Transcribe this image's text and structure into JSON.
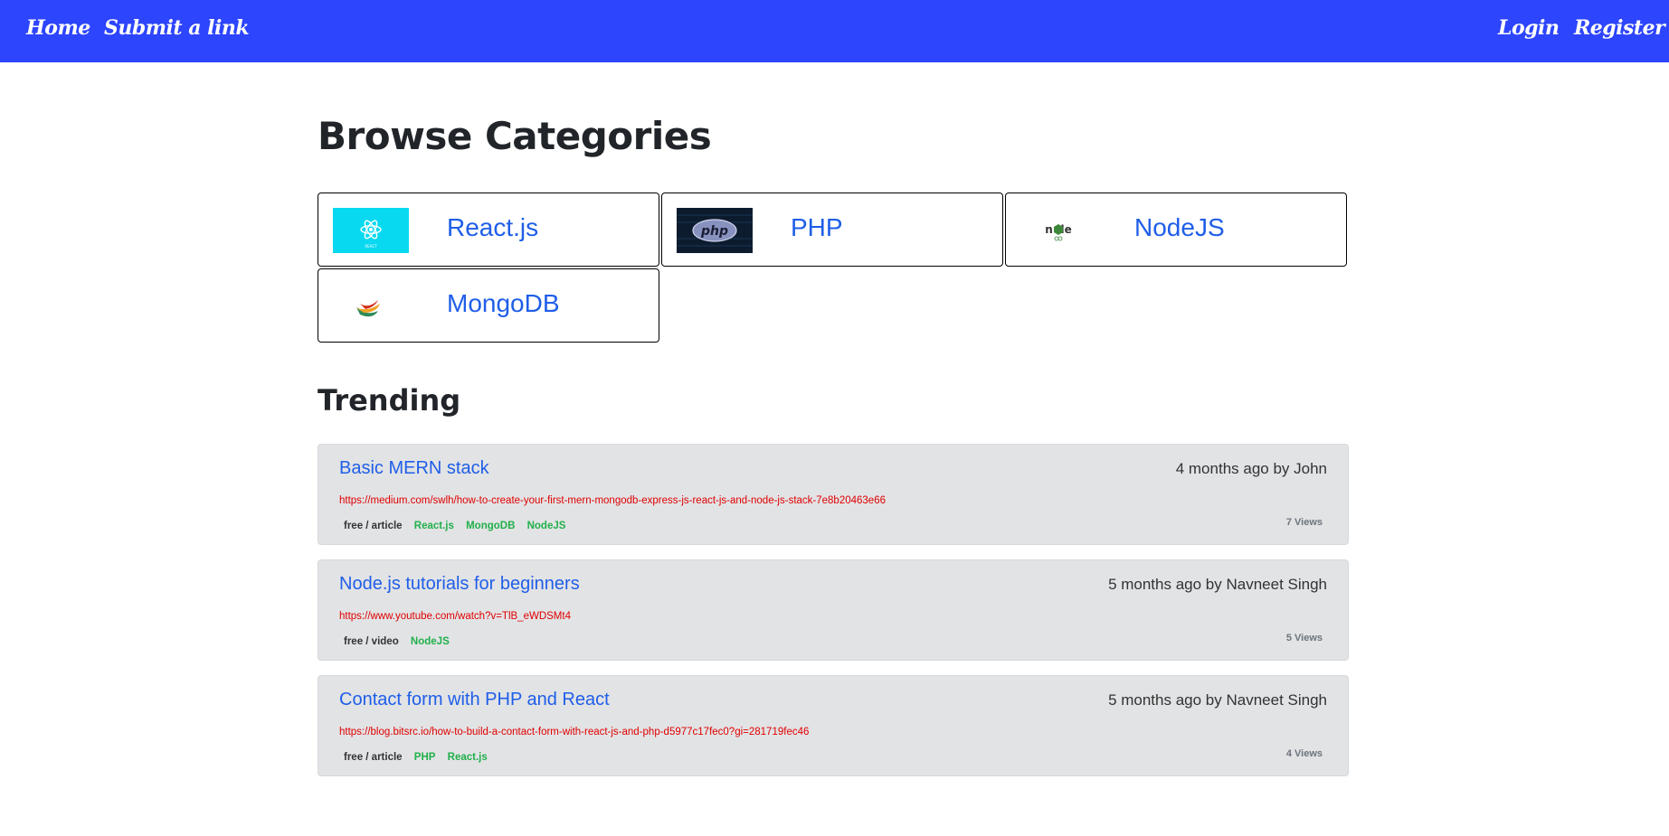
{
  "nav": {
    "home": "Home",
    "submit": "Submit a link",
    "login": "Login",
    "register": "Register"
  },
  "browse_heading": "Browse Categories",
  "categories": [
    {
      "name": "React.js",
      "icon": "react-logo-icon"
    },
    {
      "name": "PHP",
      "icon": "php-logo-icon"
    },
    {
      "name": "NodeJS",
      "icon": "nodejs-logo-icon"
    },
    {
      "name": "MongoDB",
      "icon": "mongodb-logo-icon"
    }
  ],
  "trending_heading": "Trending",
  "trending": [
    {
      "title": "Basic MERN stack",
      "meta": "4 months ago by John",
      "url": "https://medium.com/swlh/how-to-create-your-first-mern-mongodb-express-js-react-js-and-node-js-stack-7e8b20463e66",
      "type": "free / article",
      "tags": [
        "React.js",
        "MongoDB",
        "NodeJS"
      ],
      "views": "7 Views"
    },
    {
      "title": "Node.js tutorials for beginners",
      "meta": "5 months ago by Navneet Singh",
      "url": "https://www.youtube.com/watch?v=TlB_eWDSMt4",
      "type": "free / video",
      "tags": [
        "NodeJS"
      ],
      "views": "5 Views"
    },
    {
      "title": "Contact form with PHP and React",
      "meta": "5 months ago by Navneet Singh",
      "url": "https://blog.bitsrc.io/how-to-build-a-contact-form-with-react-js-and-php-d5977c17fec0?gi=281719fec46",
      "type": "free / article",
      "tags": [
        "PHP",
        "React.js"
      ],
      "views": "4 Views"
    }
  ],
  "colors": {
    "navbar": "#2d45fd",
    "link": "#1f5ee8",
    "url": "#e00000",
    "tag": "#21b04b",
    "card_bg": "#e2e3e5"
  }
}
